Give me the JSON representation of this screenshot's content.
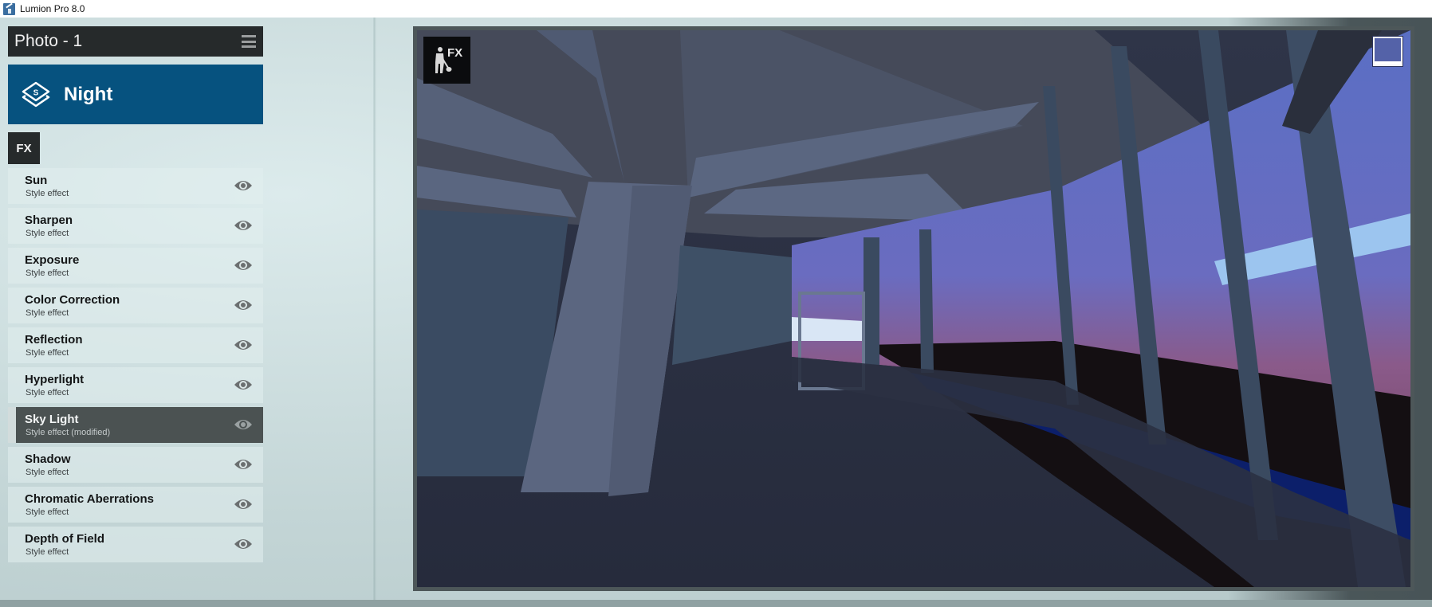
{
  "window": {
    "title": "Lumion Pro 8.0",
    "icon": "lumion-app-icon"
  },
  "panel": {
    "header_title": "Photo - 1",
    "menu_icon": "hamburger-menu-icon",
    "style": {
      "name": "Night",
      "icon": "style-layers-icon",
      "color": "#06527f"
    },
    "tab_label": "FX",
    "effects": [
      {
        "name": "Sun",
        "subtitle": "Style effect",
        "visible": true,
        "selected": false
      },
      {
        "name": "Sharpen",
        "subtitle": "Style effect",
        "visible": true,
        "selected": false
      },
      {
        "name": "Exposure",
        "subtitle": "Style effect",
        "visible": true,
        "selected": false
      },
      {
        "name": "Color Correction",
        "subtitle": "Style effect",
        "visible": true,
        "selected": false
      },
      {
        "name": "Reflection",
        "subtitle": "Style effect",
        "visible": true,
        "selected": false
      },
      {
        "name": "Hyperlight",
        "subtitle": "Style effect",
        "visible": true,
        "selected": false
      },
      {
        "name": "Sky Light",
        "subtitle": "Style effect (modified)",
        "visible": true,
        "selected": true
      },
      {
        "name": "Shadow",
        "subtitle": "Style effect",
        "visible": true,
        "selected": false
      },
      {
        "name": "Chromatic Aberrations",
        "subtitle": "Style effect",
        "visible": true,
        "selected": false
      },
      {
        "name": "Depth of Field",
        "subtitle": "Style effect",
        "visible": true,
        "selected": false
      }
    ],
    "eye_icon": "eye-visibility-icon"
  },
  "viewport": {
    "badge_label": "FX",
    "badge_icon": "worker-shovel-icon",
    "toggle_icon": "view-toggle-icon",
    "scene_description": "Night render of interior corridor with glass curtain wall"
  }
}
